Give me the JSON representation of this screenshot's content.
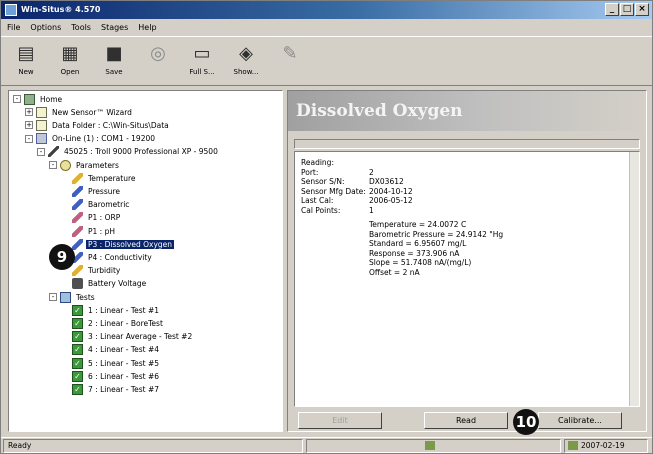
{
  "window": {
    "title": "Win-Situs® 4.570"
  },
  "menu": [
    "File",
    "Options",
    "Tools",
    "Stages",
    "Help"
  ],
  "toolbar": [
    {
      "label": "New",
      "icon": "new-icon",
      "enabled": true
    },
    {
      "label": "Open",
      "icon": "open-icon",
      "enabled": true
    },
    {
      "label": "Save",
      "icon": "save-icon",
      "enabled": true
    },
    {
      "label": "",
      "icon": "settings-icon",
      "enabled": false
    },
    {
      "label": "Full S...",
      "icon": "fullscreen-icon",
      "enabled": true
    },
    {
      "label": "Show...",
      "icon": "show-icon",
      "enabled": true
    },
    {
      "label": "",
      "icon": "wrench-icon",
      "enabled": false
    }
  ],
  "tree": [
    {
      "label": "Home",
      "icon": "house",
      "level": 0,
      "exp": "-"
    },
    {
      "label": "New Sensor™ Wizard",
      "icon": "doc",
      "level": 1,
      "exp": "+"
    },
    {
      "label": "Data Folder : C:\\Win-Situs\\Data",
      "icon": "doc",
      "level": 1,
      "exp": "+"
    },
    {
      "label": "On-Line (1) : COM1 - 19200",
      "icon": "port",
      "level": 1,
      "exp": "-"
    },
    {
      "label": "45025 : Troll 9000 Professional XP - 9500",
      "icon": "probe",
      "level": 2,
      "exp": "-"
    },
    {
      "label": "Parameters",
      "icon": "params",
      "level": 3,
      "exp": "-"
    },
    {
      "label": "Temperature",
      "icon": "pencil-yellow",
      "level": 4
    },
    {
      "label": "Pressure",
      "icon": "pencil-blue",
      "level": 4
    },
    {
      "label": "Barometric",
      "icon": "pencil-blue",
      "level": 4
    },
    {
      "label": "P1 : ORP",
      "icon": "pencil-pink",
      "level": 4
    },
    {
      "label": "P1 : pH",
      "icon": "pencil-pink",
      "level": 4
    },
    {
      "label": "P3 : Dissolved Oxygen",
      "icon": "pencil-blue",
      "level": 4,
      "selected": true
    },
    {
      "label": "P4 : Conductivity",
      "icon": "pencil-blue",
      "level": 4
    },
    {
      "label": "Turbidity",
      "icon": "pencil-yellow",
      "level": 4
    },
    {
      "label": "Battery Voltage",
      "icon": "battery",
      "level": 4
    },
    {
      "label": "Tests",
      "icon": "tests",
      "level": 3,
      "exp": "-"
    },
    {
      "label": "1 : Linear - Test #1",
      "icon": "check",
      "level": 4
    },
    {
      "label": "2 : Linear - BoreTest",
      "icon": "check",
      "level": 4
    },
    {
      "label": "3 : Linear Average - Test #2",
      "icon": "check",
      "level": 4
    },
    {
      "label": "4 : Linear - Test #4",
      "icon": "check",
      "level": 4
    },
    {
      "label": "5 : Linear - Test #5",
      "icon": "check",
      "level": 4
    },
    {
      "label": "6 : Linear - Test #6",
      "icon": "check",
      "level": 4
    },
    {
      "label": "7 : Linear - Test #7",
      "icon": "check",
      "level": 4
    }
  ],
  "badges": {
    "nine": "9",
    "ten": "10"
  },
  "detail": {
    "title": "Dissolved Oxygen",
    "fields": [
      {
        "key": "Reading:",
        "value": ""
      },
      {
        "key": "Port:",
        "value": "2"
      },
      {
        "key": "Sensor S/N:",
        "value": "DX03612"
      },
      {
        "key": "Sensor Mfg Date:",
        "value": "2004-10-12"
      },
      {
        "key": "Last Cal:",
        "value": "2006-05-12"
      },
      {
        "key": "Cal Points:",
        "value": "1"
      }
    ],
    "cal_lines": [
      "Temperature = 24.0072 C",
      "Barometric Pressure = 24.9142 \"Hg",
      "Standard = 6.95607 mg/L",
      "Response = 373.906 nA",
      "Slope = 51.7408 nA/(mg/L)",
      "Offset = 2 nA"
    ]
  },
  "buttons": {
    "first": "Edit",
    "read": "Read",
    "calibrate": "Calibrate..."
  },
  "status": {
    "left": "Ready",
    "date": "2007-02-19"
  }
}
